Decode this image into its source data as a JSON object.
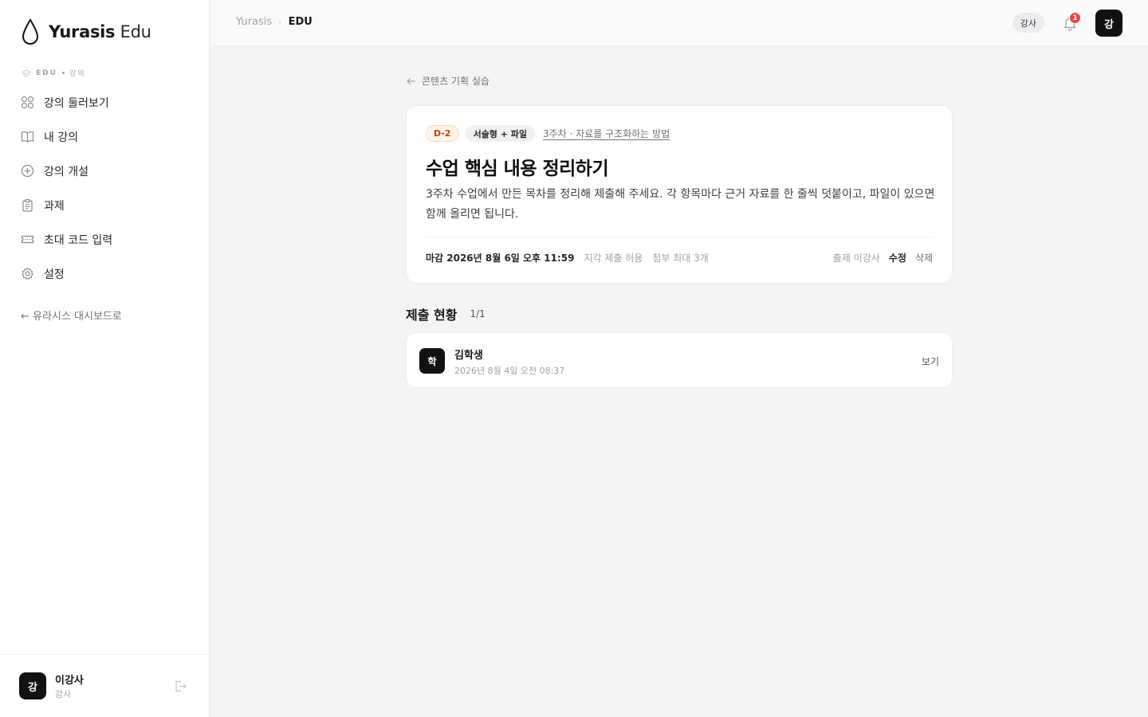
{
  "brand": {
    "name_bold": "Yurasis",
    "name_light": "Edu"
  },
  "sidebar": {
    "section_prefix": "EDU",
    "section_suffix": "강의",
    "items": [
      {
        "label": "강의 둘러보기",
        "icon": "grid-icon"
      },
      {
        "label": "내 강의",
        "icon": "book-open-icon"
      },
      {
        "label": "강의 개설",
        "icon": "plus-circle-icon"
      },
      {
        "label": "과제",
        "icon": "clipboard-icon"
      },
      {
        "label": "초대 코드 입력",
        "icon": "ticket-icon"
      },
      {
        "label": "설정",
        "icon": "gear-icon"
      }
    ],
    "back_label": "← 유라시스 대시보드로",
    "user": {
      "avatar": "강",
      "name": "이강사",
      "role": "강사"
    }
  },
  "topbar": {
    "breadcrumb_root": "Yurasis",
    "breadcrumb_sep": "›",
    "breadcrumb_current": "EDU",
    "role_label": "강사",
    "notification_count": "1",
    "avatar": "강"
  },
  "assignment": {
    "back_label": "콘텐츠 기획 실습",
    "badge_deadline": "D-2",
    "badge_type": "서술형 + 파일",
    "week_link": "3주차 · 자료를 구조화하는 방법",
    "title": "수업 핵심 내용 정리하기",
    "description": "3주차 수업에서 만든 목차를 정리해 제출해 주세요. 각 항목마다 근거 자료를 한 줄씩 덧붙이고, 파일이 있으면 함께 올리면 됩니다.",
    "due": "마감 2026년 8월 6일 오후 11:59",
    "late_policy": "지각 제출 허용",
    "attach_limit": "첨부 최대 3개",
    "author": "출제 이강사",
    "edit_label": "수정",
    "delete_label": "삭제",
    "colors": {
      "deadline_badge_bg": "#fff4ec",
      "deadline_badge_text": "#c2410c"
    }
  },
  "submissions": {
    "title": "제출 현황",
    "count": "1/1",
    "items": [
      {
        "avatar": "학",
        "name": "김학생",
        "time": "2026년 8월 4일 오전 08:37",
        "action": "보기"
      }
    ]
  }
}
